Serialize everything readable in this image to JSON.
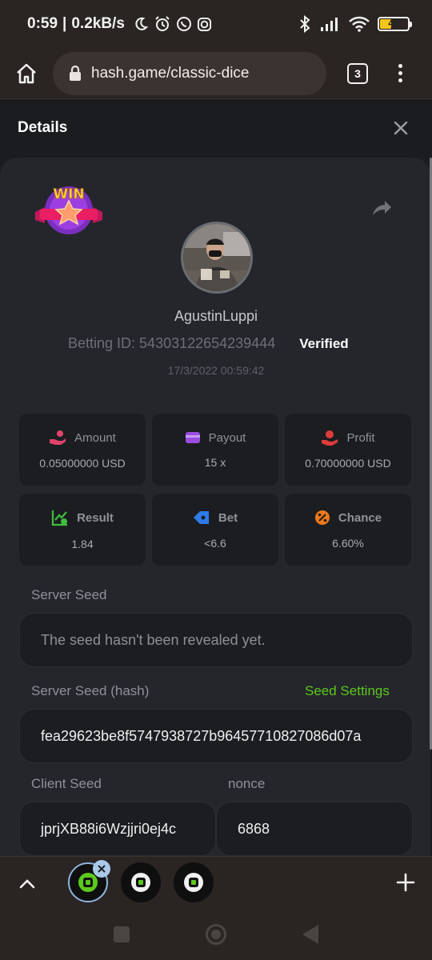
{
  "status_bar": {
    "time": "0:59",
    "network_speed": "0.2kB/s",
    "battery_level": "41",
    "left_icons": [
      "moon-icon",
      "alarm-icon",
      "whatsapp-icon",
      "instagram-icon"
    ],
    "right_icons": [
      "bluetooth-icon",
      "signal-icon",
      "wifi-icon",
      "battery-icon"
    ]
  },
  "browser": {
    "url": "hash.game/classic-dice",
    "tab_count": "3"
  },
  "modal": {
    "title": "Details",
    "badge_text": "WIN",
    "username": "AgustinLuppi",
    "betting_id": "Betting ID: 54303122654239444",
    "verified_label": "Verified",
    "timestamp": "17/3/2022 00:59:42",
    "stats": [
      {
        "label": "Amount",
        "value": "0.05000000 USD",
        "icon": "hand-coins-icon",
        "color": "#e0446a"
      },
      {
        "label": "Payout",
        "value": "15 x",
        "icon": "wallet-icon",
        "color": "#9b4de0"
      },
      {
        "label": "Profit",
        "value": "0.70000000 USD",
        "icon": "hand-money-icon",
        "color": "#e03b3b"
      },
      {
        "label": "Result",
        "value": "1.84",
        "icon": "chart-check-icon",
        "color": "#3fbf3f"
      },
      {
        "label": "Bet",
        "value": "<6.6",
        "icon": "tag-icon",
        "color": "#2f7be8"
      },
      {
        "label": "Chance",
        "value": "6.60%",
        "icon": "percent-icon",
        "color": "#f07a1a"
      }
    ],
    "server_seed": {
      "label": "Server Seed",
      "placeholder": "The seed hasn't been revealed yet."
    },
    "server_seed_hash": {
      "label": "Server Seed (hash)",
      "link": "Seed Settings",
      "value": "fea29623be8f5747938727b96457710827086d07a"
    },
    "client_seed": {
      "label": "Client Seed",
      "value": "jprjXB88i6Wzjjri0ej4c"
    },
    "nonce": {
      "label": "nonce",
      "value": "6868"
    }
  },
  "colors": {
    "accent_green": "#5cc81d",
    "background": "#1b1c20",
    "card": "#24262b"
  }
}
